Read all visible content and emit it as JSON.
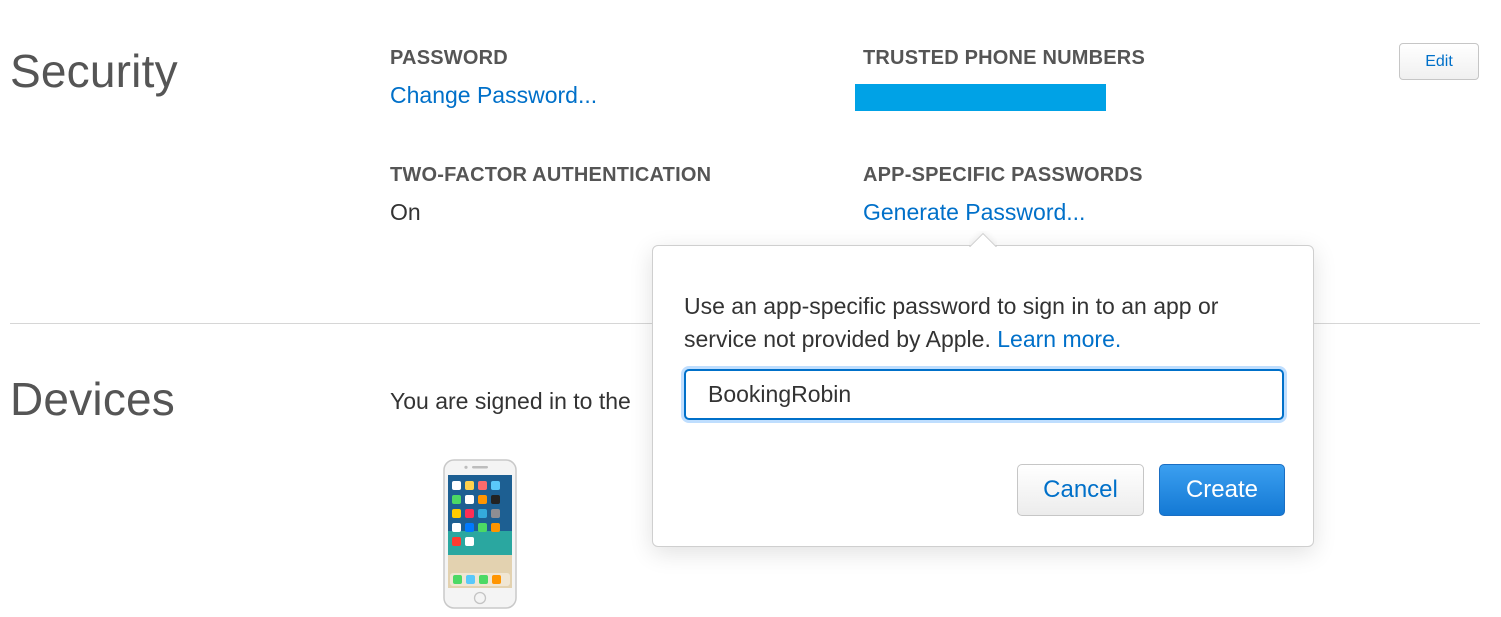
{
  "security": {
    "title": "Security",
    "edit_label": "Edit",
    "password": {
      "label": "PASSWORD",
      "link": "Change Password..."
    },
    "trusted_phone": {
      "label": "TRUSTED PHONE NUMBERS",
      "redaction_color": "#00a2e6"
    },
    "two_factor": {
      "label": "TWO-FACTOR AUTHENTICATION",
      "value": "On"
    },
    "app_specific": {
      "label": "APP-SPECIFIC PASSWORDS",
      "link": "Generate Password..."
    }
  },
  "devices": {
    "title": "Devices",
    "description_visible": "You are signed in to the",
    "device_icon": "iphone-icon"
  },
  "popover": {
    "message": "Use an app-specific password to sign in to an app or service not provided by Apple.",
    "learn_more": "Learn more.",
    "input_value": "BookingRobin",
    "cancel_label": "Cancel",
    "create_label": "Create"
  },
  "colors": {
    "accent": "#0070c9",
    "primary_button": "#1a85e0",
    "text": "#333333",
    "heading": "#555555"
  }
}
